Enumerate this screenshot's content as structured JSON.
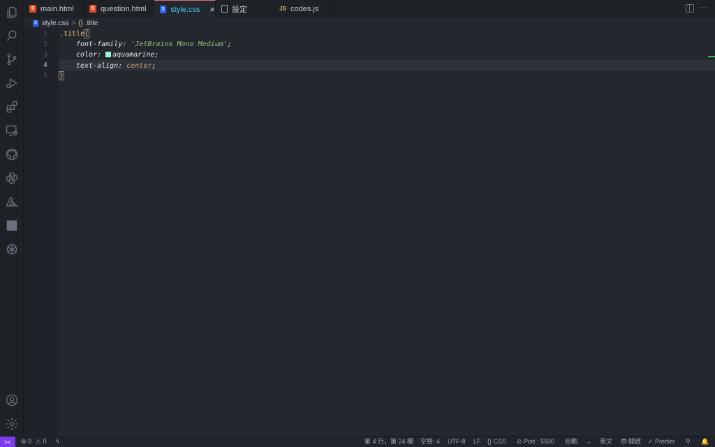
{
  "tabs": [
    {
      "label": "main.html",
      "type": "html",
      "icon": "html5-icon"
    },
    {
      "label": "question.html",
      "type": "html",
      "icon": "html5-icon"
    },
    {
      "label": "style.css",
      "type": "css",
      "icon": "css3-icon",
      "active": true,
      "close": "×"
    },
    {
      "label": "設定",
      "type": "doc",
      "icon": "file-icon"
    },
    {
      "label": "codes.js",
      "type": "js",
      "icon": "js-icon",
      "icon_text": "JS"
    }
  ],
  "breadcrumb": {
    "file": "style.css",
    "separator": ">",
    "symbol_icon": "{}",
    "symbol": ".title"
  },
  "editor": {
    "line_numbers": [
      "1",
      "2",
      "3",
      "4",
      "5"
    ],
    "current_line": "4",
    "lines": {
      "l1_selector": ".title",
      "l1_brace": "{",
      "l2_prop": "font-family:",
      "l2_value": "'JetBrains Mono Medium'",
      "l2_semi": ";",
      "l3_prop": "color:",
      "l3_value": "aquamarine",
      "l3_semi": ";",
      "l4_prop": "text-align:",
      "l4_value": "center",
      "l4_semi": ";",
      "l5_brace": "}"
    },
    "swatch_color": "#7fffd4"
  },
  "status": {
    "remote": "><",
    "errors": "⊗ 0",
    "warnings": "⚠ 0",
    "position": "第 4 行，第 24 欄",
    "spaces": "空格: 4",
    "encoding": "UTF-8",
    "eol": "LF",
    "language": "{} CSS",
    "port": "⊘ Port : 5500",
    "auto": "自動",
    "arrow": "→",
    "input": "英文",
    "open": "開啟",
    "prettier": "✓ Prettier"
  },
  "colors": {
    "accent_tab": "#4fc1ff",
    "active_tab_border": "#e06c75",
    "remote_bg": "#7c3aed"
  }
}
